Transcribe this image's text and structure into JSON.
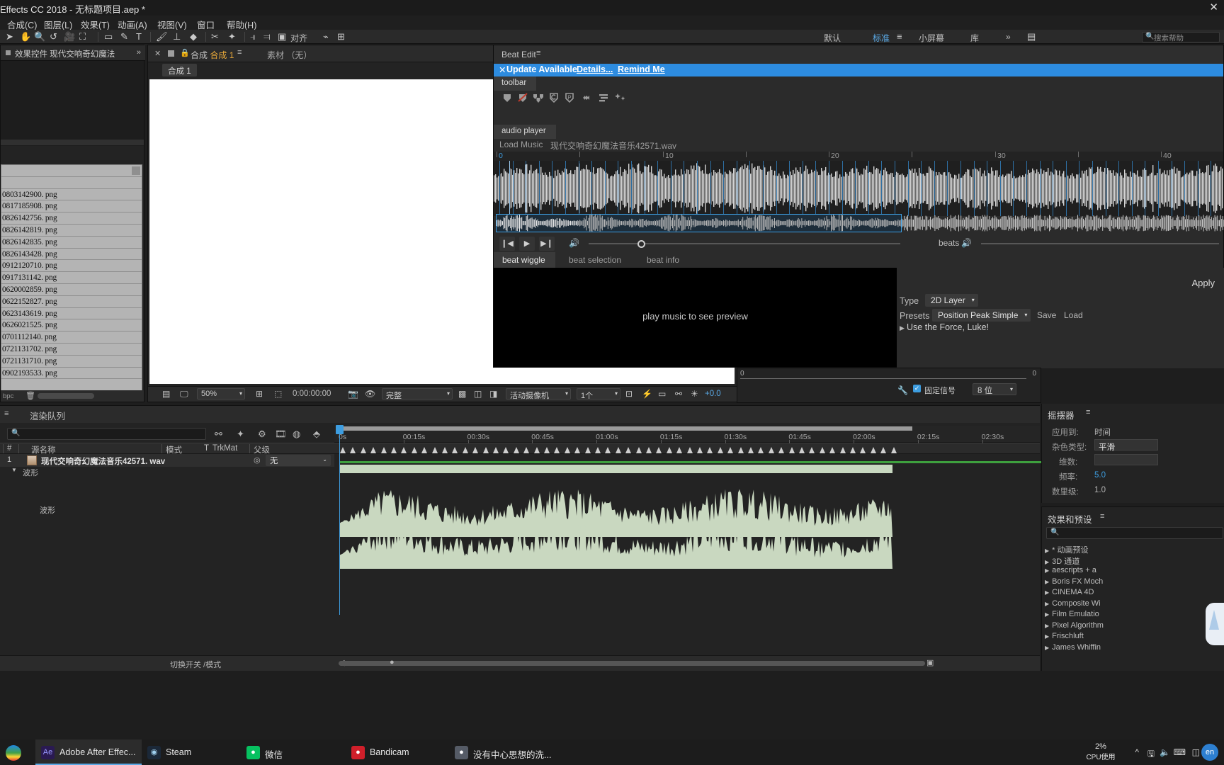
{
  "titlebar": {
    "title": "Effects CC 2018 - 无标题项目.aep *",
    "close": "✕"
  },
  "menubar": {
    "items": [
      "合成(C)",
      "图层(L)",
      "效果(T)",
      "动画(A)",
      "视图(V)",
      "窗口",
      "帮助(H)"
    ]
  },
  "ae_toolbar": {
    "align_label": "对齐",
    "workspaces": [
      "默认",
      "标准",
      "小屏幕",
      "库"
    ],
    "selected_workspace": "标准",
    "overflow": "»",
    "search_placeholder": "搜索帮助"
  },
  "left_panel": {
    "title": "效果控件 现代交响奇幻魔法",
    "chevron": "»",
    "bit_depth": "bpc",
    "files": [
      "",
      "",
      "0803142900. png",
      "0817185908. png",
      "0826142756. png",
      "0826142819. png",
      "0826142835. png",
      "0826143428. png",
      "0912120710. png",
      "0917131142. png",
      "0620002859. png",
      "0622152827. png",
      "0623143619. png",
      "0626021525. png",
      "0701112140. png",
      "0721131702. png",
      "0721131710. png",
      "0902193533. png",
      ""
    ]
  },
  "comp_panel": {
    "close": "✕",
    "tab_prefix": "合成",
    "tab_name": "合成 1",
    "burger": "≡",
    "material_tab": "素材 （无）",
    "sub_tab": "合成 1",
    "zoom": "50%",
    "timecode": "0:00:00:00",
    "quality": "完整",
    "camera": "活动摄像机",
    "view_count": "1个",
    "exposure": "+0.0"
  },
  "beat_panel": {
    "title": "Beat Edit",
    "burger": "≡",
    "update_bar": {
      "close": "✕",
      "text": "Update Available",
      "details": "Details...",
      "remind": "Remind Me"
    },
    "toolbar_tab": "toolbar",
    "audio_player_tab": "audio player",
    "load_music_label": "Load Music",
    "file_name": "现代交响奇幻魔法音乐42571.wav",
    "ruler_labels": [
      "0",
      "10",
      "20",
      "30",
      "40"
    ],
    "transport": {
      "prev": "❙◀",
      "play": "▶",
      "next": "▶❙",
      "volume": "🔊",
      "beats_label": "beats"
    },
    "tabs": [
      {
        "label": "beat wiggle",
        "active": true
      },
      {
        "label": "beat selection",
        "active": false
      },
      {
        "label": "beat info",
        "active": false
      }
    ],
    "preview_message": "play music to see preview",
    "apply_label": "Apply",
    "type_label": "Type",
    "type_value": "2D Layer",
    "presets_label": "Presets",
    "presets_value": "Position Peak Simple",
    "save_label": "Save",
    "load_label": "Load",
    "force_label": "Use the Force, Luke!"
  },
  "preview_panel": {
    "zero": "0",
    "fixed_signal": "固定信号",
    "bit": "8 位",
    "check": "✓"
  },
  "timeline": {
    "burger": "≡",
    "title": "渲染队列",
    "search_placeholder": "",
    "columns": [
      "#",
      "源名称",
      "模式",
      "T",
      "TrkMat",
      "父级"
    ],
    "layer": {
      "index": "1",
      "name": "现代交响奇幻魔法音乐42571. wav",
      "parent": "无"
    },
    "sub_rows": [
      "波形",
      "波形"
    ],
    "ruler_labels": [
      "0s",
      "00:15s",
      "00:30s",
      "00:45s",
      "01:00s",
      "01:15s",
      "01:30s",
      "01:45s",
      "02:00s",
      "02:15s",
      "02:30s"
    ],
    "bottom_label": "切换开关 /模式"
  },
  "wiggler": {
    "title": "摇摆器",
    "burger": "≡",
    "rows": [
      {
        "label": "应用到:",
        "value": "时间"
      },
      {
        "label": "杂色类型:",
        "value": "平滑"
      },
      {
        "label": "维数:",
        "value": ""
      },
      {
        "label": "频率:",
        "value": "5.0",
        "blue": true
      },
      {
        "label": "数里级:",
        "value": "1.0"
      }
    ]
  },
  "effects_presets": {
    "title": "效果和预设",
    "burger": "≡",
    "items": [
      "* 动画预设",
      "3D 通道",
      "aescripts + a",
      "Boris FX Moch",
      "CINEMA 4D",
      "Composite Wi",
      "Film Emulatio",
      "Pixel Algorithm",
      "Frischluft",
      "James Whiffin"
    ]
  },
  "taskbar": {
    "items": [
      {
        "label": "Adobe After Effec...",
        "color": "#2a1a52",
        "glyph": "Ae",
        "active": true
      },
      {
        "label": "Steam",
        "color": "#1b2838",
        "glyph": "◉",
        "active": false
      },
      {
        "label": "微信",
        "color": "#07c160",
        "glyph": "●",
        "active": false
      },
      {
        "label": "Bandicam",
        "color": "#d01f2a",
        "glyph": "●",
        "active": false
      },
      {
        "label": "没有中心思想的洗...",
        "color": "#555b66",
        "glyph": "●",
        "active": false
      }
    ],
    "cpu_value": "2%",
    "cpu_label": "CPU使用",
    "tray": [
      "^",
      "🖫",
      "🔈",
      "⌨",
      "◫"
    ],
    "lang_badge": "en"
  }
}
